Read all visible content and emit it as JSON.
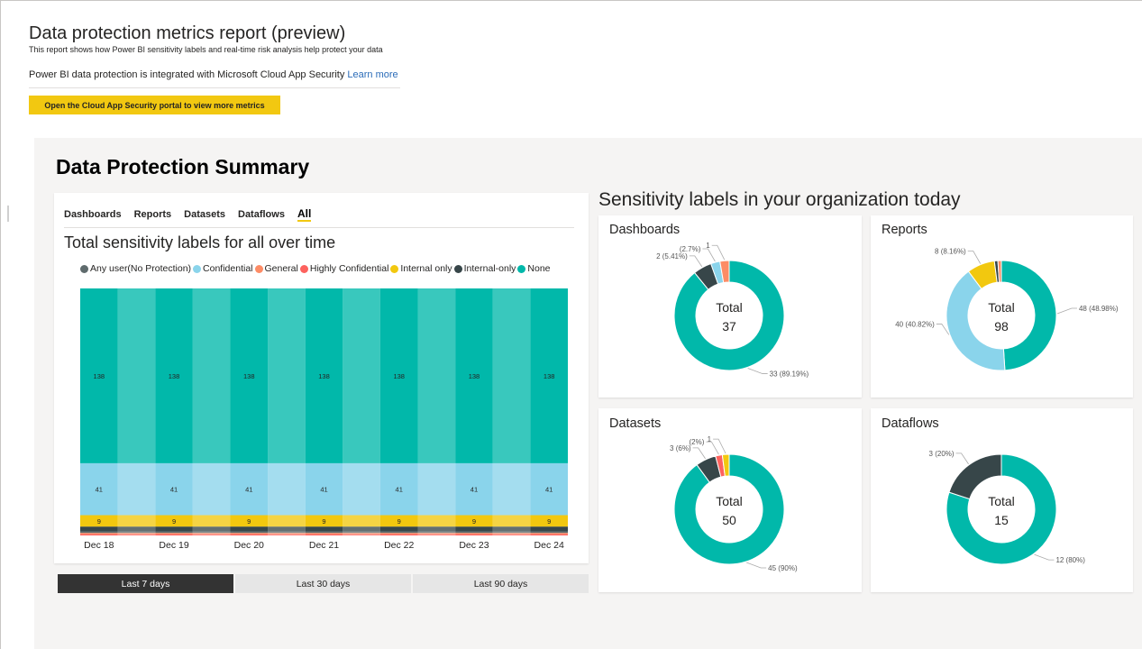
{
  "header": {
    "title": "Data protection metrics report (preview)",
    "subtitle": "This report shows how Power BI sensitivity labels and real-time risk analysis help protect your data",
    "integration_text": "Power BI data protection is integrated with Microsoft Cloud App Security",
    "learn_more": "Learn more",
    "cta_label": "Open the Cloud App Security portal to view more metrics"
  },
  "summary": {
    "title": "Data Protection Summary",
    "tabs": [
      {
        "label": "Dashboards",
        "active": false
      },
      {
        "label": "Reports",
        "active": false
      },
      {
        "label": "Datasets",
        "active": false
      },
      {
        "label": "Dataflows",
        "active": false
      },
      {
        "label": "All",
        "active": true
      }
    ],
    "chart_title": "Total sensitivity labels for all over time",
    "time_ranges": [
      {
        "label": "Last 7 days",
        "active": true
      },
      {
        "label": "Last 30 days",
        "active": false
      },
      {
        "label": "Last 90 days",
        "active": false
      }
    ]
  },
  "colors": {
    "Any user(No Protection)": "#5f6b6d",
    "Confidential": "#8ad4eb",
    "General": "#fd8c66",
    "Highly Confidential": "#fd625e",
    "Internal only": "#f2c80f",
    "Internal-only": "#374649",
    "None": "#01b8aa",
    "accent": "#f2c811",
    "link": "#2b6cb8"
  },
  "chart_data": [
    {
      "type": "bar",
      "stacked": true,
      "title": "Total sensitivity labels for all over time",
      "categories": [
        "Dec 18",
        "Dec 19",
        "Dec 20",
        "Dec 21",
        "Dec 22",
        "Dec 23",
        "Dec 24"
      ],
      "legend_position": "top",
      "series": [
        {
          "name": "Highly Confidential",
          "values": [
            1,
            1,
            1,
            1,
            1,
            1,
            1
          ]
        },
        {
          "name": "General",
          "values": [
            1,
            1,
            1,
            1,
            1,
            1,
            1
          ]
        },
        {
          "name": "Any user(No Protection)",
          "values": [
            1,
            1,
            1,
            1,
            1,
            1,
            1
          ]
        },
        {
          "name": "Internal-only",
          "values": [
            4,
            4,
            4,
            4,
            4,
            4,
            4
          ]
        },
        {
          "name": "Internal only",
          "values": [
            9,
            9,
            9,
            9,
            9,
            9,
            9
          ]
        },
        {
          "name": "Confidential",
          "values": [
            41,
            41,
            41,
            41,
            41,
            41,
            41
          ]
        },
        {
          "name": "None",
          "values": [
            138,
            138,
            138,
            138,
            138,
            138,
            138
          ]
        }
      ],
      "data_labels": [
        "Internal only",
        "Confidential",
        "None"
      ]
    },
    {
      "type": "pie",
      "donut": true,
      "title": "Dashboards",
      "center_label": "Total",
      "total": 37,
      "slices": [
        {
          "name": "None",
          "value": 33,
          "label": "33 (89.19%)"
        },
        {
          "name": "Internal-only",
          "value": 2,
          "label": "2 (5.41%)"
        },
        {
          "name": "Confidential",
          "value": 1,
          "label": "(2.7%)"
        },
        {
          "name": "General",
          "value": 1,
          "label": "1"
        }
      ]
    },
    {
      "type": "pie",
      "donut": true,
      "title": "Reports",
      "center_label": "Total",
      "total": 98,
      "slices": [
        {
          "name": "None",
          "value": 48,
          "label": "48 (48.98%)"
        },
        {
          "name": "Confidential",
          "value": 40,
          "label": "40 (40.82%)"
        },
        {
          "name": "Internal only",
          "value": 8,
          "label": "8 (8.16%)"
        },
        {
          "name": "Internal-only",
          "value": 1,
          "label": ""
        },
        {
          "name": "General",
          "value": 1,
          "label": ""
        }
      ]
    },
    {
      "type": "pie",
      "donut": true,
      "title": "Datasets",
      "center_label": "Total",
      "total": 50,
      "slices": [
        {
          "name": "None",
          "value": 45,
          "label": "45 (90%)"
        },
        {
          "name": "Internal-only",
          "value": 3,
          "label": "3 (6%)"
        },
        {
          "name": "Highly Confidential",
          "value": 1,
          "label": "(2%)"
        },
        {
          "name": "Internal only",
          "value": 1,
          "label": "1"
        }
      ]
    },
    {
      "type": "pie",
      "donut": true,
      "title": "Dataflows",
      "center_label": "Total",
      "total": 15,
      "slices": [
        {
          "name": "None",
          "value": 12,
          "label": "12 (80%)"
        },
        {
          "name": "Internal-only",
          "value": 3,
          "label": "3 (20%)"
        }
      ]
    }
  ],
  "sensitivity": {
    "title": "Sensitivity labels in your organization today"
  }
}
